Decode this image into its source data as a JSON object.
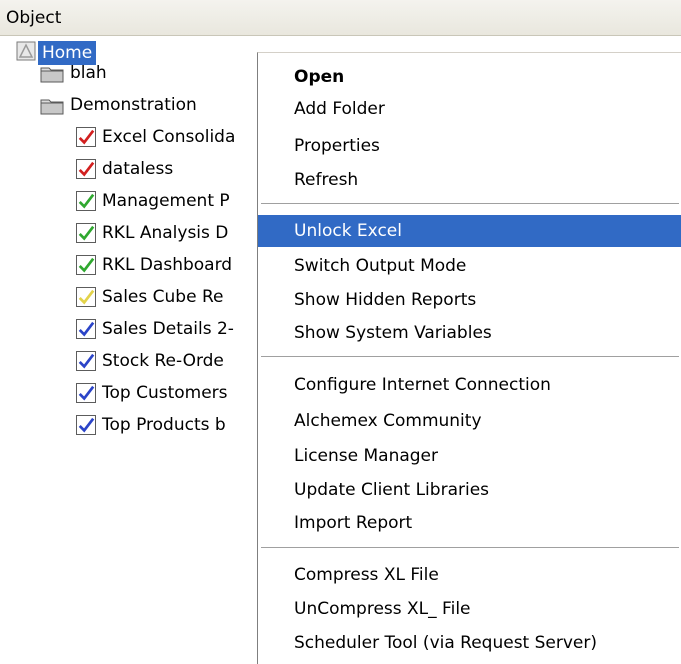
{
  "header": {
    "column_label": "Object"
  },
  "tree": {
    "root": {
      "label": "Home"
    },
    "folders": [
      {
        "label": "blah"
      },
      {
        "label": "Demonstration"
      }
    ],
    "reports": [
      {
        "label": "Excel Consolida",
        "check_color": "#d21f1f"
      },
      {
        "label": "dataless",
        "check_color": "#d21f1f"
      },
      {
        "label": "Management P",
        "check_color": "#2fa82f"
      },
      {
        "label": "RKL Analysis D",
        "check_color": "#2fa82f"
      },
      {
        "label": "RKL Dashboard",
        "check_color": "#2fa82f"
      },
      {
        "label": "Sales Cube Re",
        "check_color": "#e3d34a"
      },
      {
        "label": "Sales Details 2-",
        "check_color": "#2b44c8"
      },
      {
        "label": "Stock Re-Orde",
        "check_color": "#2b44c8"
      },
      {
        "label": "Top Customers",
        "check_color": "#2b44c8"
      },
      {
        "label": "Top Products b",
        "check_color": "#2b44c8"
      }
    ]
  },
  "menu": {
    "items": [
      {
        "label": "Open"
      },
      {
        "label": "Add Folder"
      },
      {
        "label": "Properties"
      },
      {
        "label": "Refresh"
      },
      {
        "label": "Unlock Excel"
      },
      {
        "label": "Switch Output Mode"
      },
      {
        "label": "Show Hidden Reports"
      },
      {
        "label": "Show System Variables"
      },
      {
        "label": "Configure Internet Connection"
      },
      {
        "label": "Alchemex Community"
      },
      {
        "label": "License Manager"
      },
      {
        "label": "Update Client Libraries"
      },
      {
        "label": "Import Report"
      },
      {
        "label": "Compress XL File"
      },
      {
        "label": "UnCompress XL_ File"
      },
      {
        "label": "Scheduler Tool (via Request Server)"
      }
    ]
  },
  "colors": {
    "selection": "#316ac5"
  }
}
